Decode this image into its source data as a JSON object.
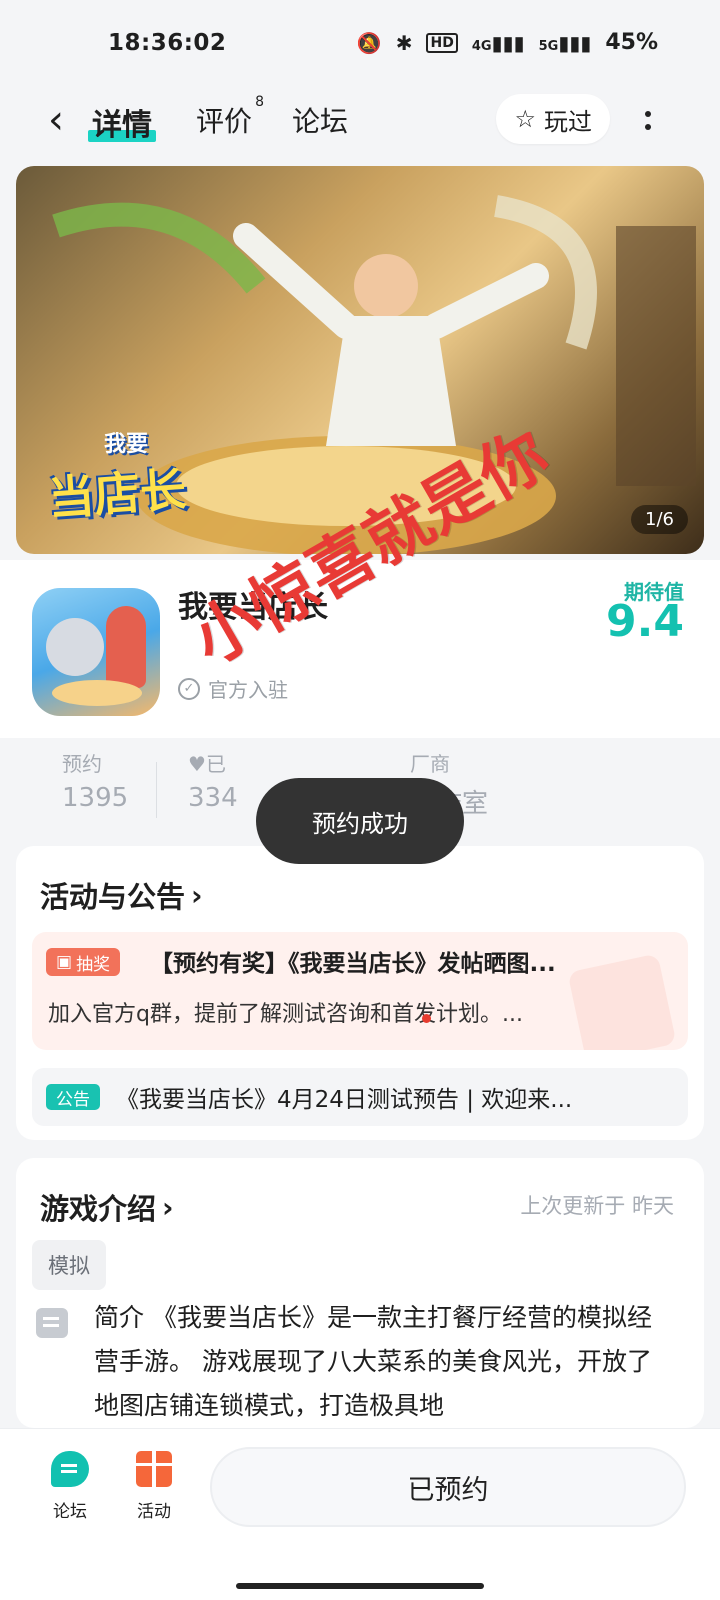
{
  "status_bar": {
    "time": "18:36:02",
    "battery": "45%",
    "network_1": "4G",
    "network_2": "5G",
    "hd": "HD"
  },
  "header": {
    "back_label": "‹",
    "tabs": [
      {
        "label": "详情",
        "active": true
      },
      {
        "label": "评价",
        "badge": "8"
      },
      {
        "label": "论坛"
      }
    ],
    "played_label": "玩过"
  },
  "banner": {
    "page_indicator": "1/6",
    "logo_line1": "我要",
    "logo_line2": "当店长"
  },
  "game": {
    "name": "我要当店长",
    "official_label": "官方入驻",
    "score_label": "期待值",
    "score": "9.4"
  },
  "stats": {
    "reserve_label": "预约",
    "reserve_value": "1395",
    "follow_label": "已",
    "follow_value": "334",
    "vendor_label": "厂商",
    "vendor_value": "工作室"
  },
  "toast": "预约成功",
  "watermark": "小惊喜就是你",
  "activity": {
    "title": "活动与公告",
    "promo_tag": "抽奖",
    "promo_title": "【预约有奖】《我要当店长》发帖晒图...",
    "promo_desc": "加入官方q群，提前了解测试咨询和首发计划。...",
    "notice_tag": "公告",
    "notice_text": "《我要当店长》4月24日测试预告 | 欢迎来..."
  },
  "intro": {
    "title": "游戏介绍",
    "updated": "上次更新于 昨天",
    "genre": "模拟",
    "text": "简介 《我要当店长》是一款主打餐厅经营的模拟经营手游。 游戏展现了八大菜系的美食风光，开放了地图店铺连锁模式，打造极具地"
  },
  "bottom": {
    "forum_label": "论坛",
    "activity_label": "活动",
    "reserved_label": "已预约"
  },
  "colors": {
    "accent": "#14c1b0",
    "promo": "#f2725a",
    "watermark": "#e83a35"
  }
}
